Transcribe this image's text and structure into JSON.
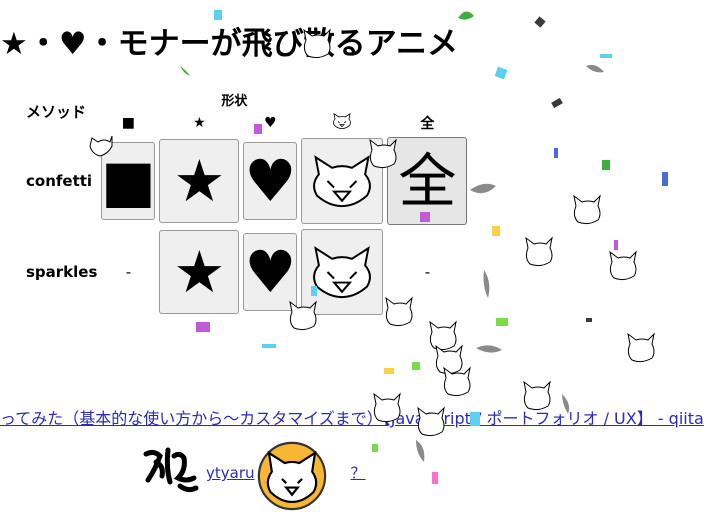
{
  "title": "★・♥・モナーが飛び散るアニメ",
  "table": {
    "method_header": "メソッド",
    "shape_header": "形状",
    "shapes": [
      "■",
      "★",
      "♥",
      "monar-face",
      "全"
    ],
    "rows": [
      {
        "label": "confetti",
        "cells": [
          "■",
          "★",
          "♥",
          "monar-face",
          "全"
        ],
        "selected_index": 4
      },
      {
        "label": "sparkles",
        "cells": [
          "-",
          "★",
          "♥",
          "monar-face",
          "-"
        ]
      }
    ]
  },
  "footer": {
    "article_link": "ってみた（基本的な使い方から〜カスタマイズまで）【JavaScript / ポートフォリオ / UX】 - qiita",
    "author_name": "ytyaru",
    "author_suffix": "？"
  },
  "icons": [
    "monar-face-icon",
    "yaru-logo",
    "author-avatar"
  ],
  "colors": {
    "confetti": [
      "#5bd0f0",
      "#c05ad6",
      "#7bdc4b",
      "#f6d24a",
      "#8a8a8a",
      "#4a6adf",
      "#3fae3f",
      "#ff6fd0"
    ],
    "avatar_bg": "#f7b733"
  }
}
